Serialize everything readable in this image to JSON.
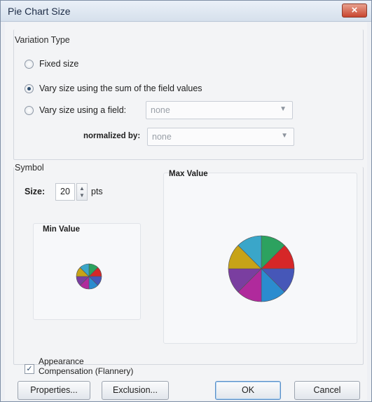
{
  "window": {
    "title": "Pie Chart Size",
    "close_glyph": "×"
  },
  "variation": {
    "group_label": "Variation Type",
    "options": [
      {
        "label": "Fixed size",
        "selected": false
      },
      {
        "label": "Vary size using the sum of the field values",
        "selected": true
      },
      {
        "label": "Vary size using a field:",
        "selected": false
      }
    ],
    "field_combo": {
      "value": "none",
      "disabled": true
    },
    "normalized_label": "normalized by:",
    "normalized_combo": {
      "value": "none",
      "disabled": true
    }
  },
  "symbol": {
    "group_label": "Symbol",
    "size_label": "Size:",
    "size_value": "20",
    "size_unit": "pts",
    "min_label": "Min Value",
    "max_label": "Max Value"
  },
  "pie": {
    "slice_colors": [
      "#2ca25f",
      "#d62728",
      "#4657b8",
      "#2b8ccf",
      "#b02a9c",
      "#7a3ea0",
      "#c7a317",
      "#3aa6c9"
    ],
    "edge_color": "#555555"
  },
  "appearance": {
    "checked": true,
    "line1": "Appearance",
    "line2": "Compensation (Flannery)"
  },
  "buttons": {
    "properties": "Properties...",
    "exclusion": "Exclusion...",
    "ok": "OK",
    "cancel": "Cancel"
  }
}
